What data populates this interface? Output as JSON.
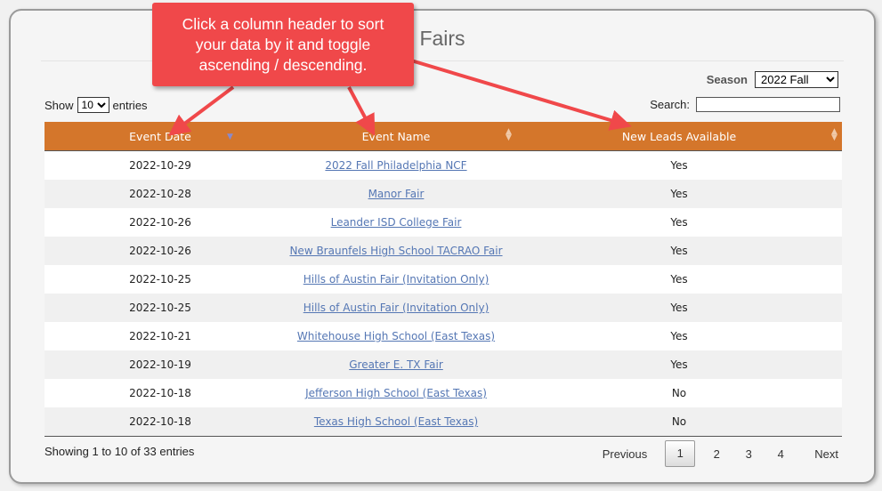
{
  "page": {
    "title": "Fairs",
    "season_label": "Season",
    "season_selected": "2022 Fall",
    "show_label": "Show",
    "entries_value": "10",
    "entries_label": "entries",
    "search_label": "Search:",
    "search_value": ""
  },
  "table": {
    "headers": [
      "Event Date",
      "Event Name",
      "New Leads Available"
    ],
    "sort_column": "Event Date",
    "sort_direction": "ascending",
    "rows": [
      {
        "date": "2022-10-29",
        "name": "2022 Fall Philadelphia NCF",
        "leads": "Yes"
      },
      {
        "date": "2022-10-28",
        "name": "Manor Fair",
        "leads": "Yes"
      },
      {
        "date": "2022-10-26",
        "name": "Leander ISD College Fair",
        "leads": "Yes"
      },
      {
        "date": "2022-10-26",
        "name": "New Braunfels High School TACRAO Fair",
        "leads": "Yes"
      },
      {
        "date": "2022-10-25",
        "name": "Hills of Austin Fair (Invitation Only)",
        "leads": "Yes"
      },
      {
        "date": "2022-10-25",
        "name": "Hills of Austin Fair (Invitation Only)",
        "leads": "Yes"
      },
      {
        "date": "2022-10-21",
        "name": "Whitehouse High School (East Texas)",
        "leads": "Yes"
      },
      {
        "date": "2022-10-19",
        "name": "Greater E. TX Fair",
        "leads": "Yes"
      },
      {
        "date": "2022-10-18",
        "name": "Jefferson High School (East Texas)",
        "leads": "No"
      },
      {
        "date": "2022-10-18",
        "name": "Texas High School (East Texas)",
        "leads": "No"
      }
    ]
  },
  "footer": {
    "info": "Showing 1 to 10 of 33 entries",
    "previous_label": "Previous",
    "pages": [
      "1",
      "2",
      "3",
      "4"
    ],
    "current_page": "1",
    "next_label": "Next"
  },
  "callout": {
    "lines": [
      "Click a column header to sort",
      "your data by it and toggle",
      "ascending / descending."
    ],
    "color": "#f0484a"
  },
  "colors": {
    "header_bg": "#d4762b",
    "link": "#5577b4"
  }
}
